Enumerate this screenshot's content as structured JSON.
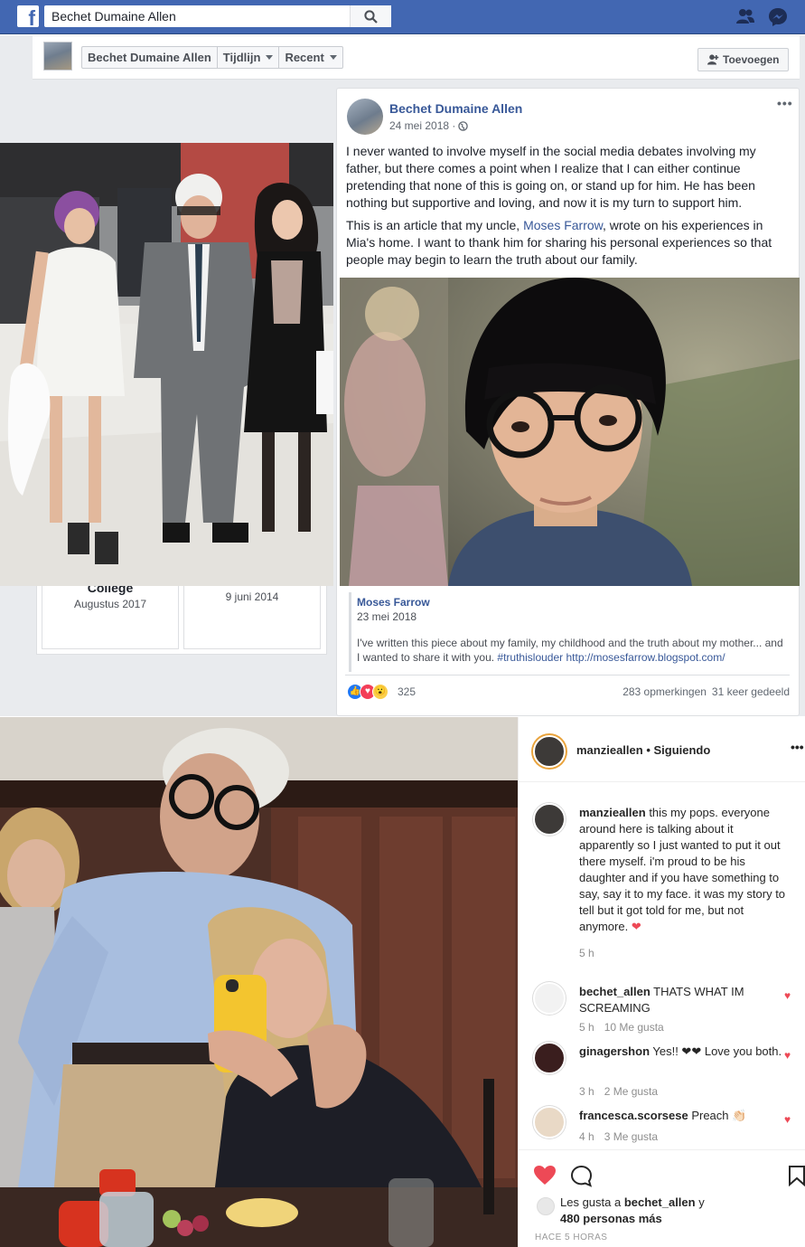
{
  "facebook": {
    "search_value": "Bechet Dumaine Allen",
    "nav": {
      "profile_name": "Bechet Dumaine Allen",
      "timeline_label": "Tijdlijn",
      "recent_label": "Recent",
      "add_button_label": "Toevoegen"
    },
    "life_events": [
      {
        "title": "College",
        "date": "Augustus 2017"
      },
      {
        "title": "",
        "date": "9 juni 2014"
      }
    ],
    "post": {
      "author": "Bechet Dumaine Allen",
      "date": "24 mei 2018",
      "date_separator": "·",
      "paragraph_1": "I never wanted to involve myself in the social media debates involving my father, but there comes a point when I realize that I can either continue pretending that none of this is going on, or stand up for him. He has been nothing but supportive and loving, and now it is my turn to support him.",
      "paragraph_2_before": "This is an article that my uncle, ",
      "paragraph_2_link": "Moses Farrow",
      "paragraph_2_after": ", wrote on his experiences in Mia's home. I want to thank him for sharing his personal experiences so that people may begin to learn the truth about our family.",
      "shared": {
        "name": "Moses Farrow",
        "date": "23 mei 2018",
        "text_1": "I've written this piece about my family, my childhood and the truth about my mother... and I wanted to share it with you. ",
        "hashtag": "#truthislouder",
        "url": "http://mosesfarrow.blogspot.com/"
      },
      "reaction_count": "325",
      "comments": "283 opmerkingen",
      "shares": "31 keer gedeeld"
    }
  },
  "instagram": {
    "header_username": "manzieallen",
    "header_follow": " • Siguiendo",
    "caption": {
      "username": "manzieallen",
      "text": " this my pops. everyone around here is talking about it apparently so I just wanted to put it out there myself. i'm proud to be his daughter and if you have something to say, say it to my face. it was my story to tell but it got told for me, but not anymore. ",
      "heart": "❤",
      "time": "5 h"
    },
    "comments": [
      {
        "username": "bechet_allen",
        "text": " THATS WHAT IM SCREAMING",
        "time": "5 h",
        "likes": "10 Me gusta"
      },
      {
        "username": "ginagershon",
        "text": " Yes!! ❤❤ Love you both.",
        "time": "3 h",
        "likes": "2 Me gusta"
      },
      {
        "username": "francesca.scorsese",
        "text": " Preach 👏🏻",
        "time": "4 h",
        "likes": "3 Me gusta"
      }
    ],
    "likes_prefix": "Les gusta a ",
    "likes_user": "bechet_allen",
    "likes_suffix": " y",
    "likes_others": "480 personas más",
    "posted_ago": "HACE 5 HORAS",
    "colors": {
      "heart": "#ed4956",
      "story_ring": "#e9a33c",
      "verified": "#3897f0"
    }
  }
}
